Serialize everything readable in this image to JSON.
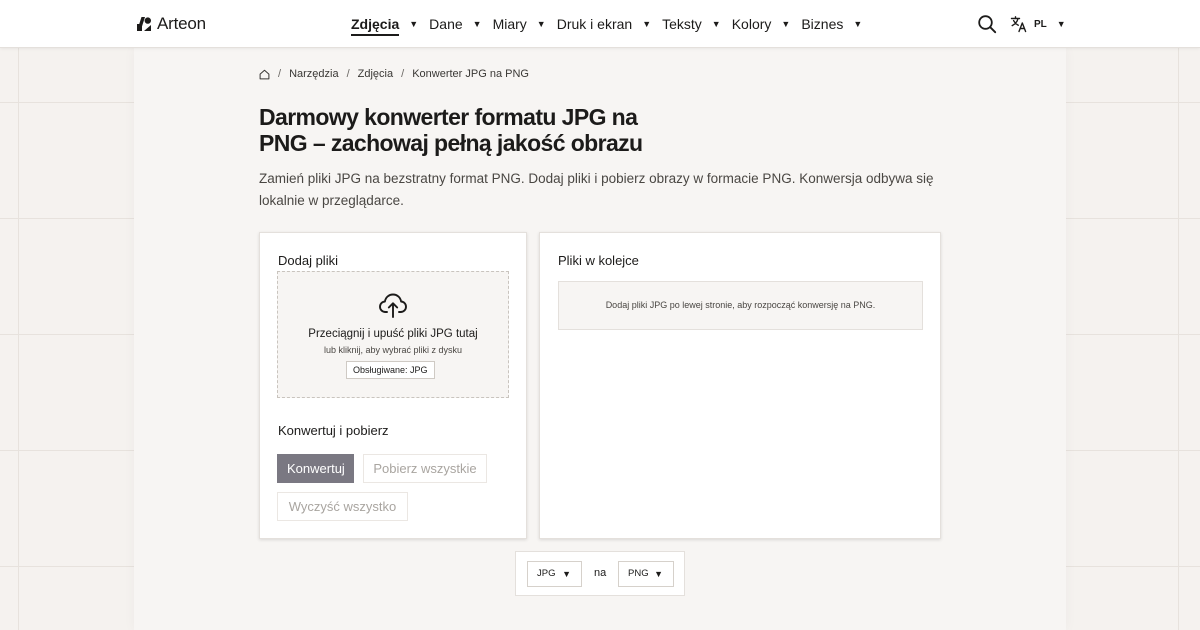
{
  "brand": {
    "name": "Arteon"
  },
  "nav": [
    {
      "label": "Zdjęcia",
      "active": true
    },
    {
      "label": "Dane",
      "active": false
    },
    {
      "label": "Miary",
      "active": false
    },
    {
      "label": "Druk i ekran",
      "active": false
    },
    {
      "label": "Teksty",
      "active": false
    },
    {
      "label": "Kolory",
      "active": false
    },
    {
      "label": "Biznes",
      "active": false
    }
  ],
  "header": {
    "language": "PL",
    "search_icon": "search-icon",
    "language_icon": "translate-icon"
  },
  "breadcrumb": {
    "home_icon": "home-icon",
    "items": [
      "Narzędzia",
      "Zdjęcia"
    ],
    "current": "Konwerter JPG na PNG"
  },
  "page": {
    "title": "Darmowy konwerter formatu JPG na PNG – zachowaj pełną jakość obrazu",
    "description": "Zamień pliki JPG na bezstratny format PNG. Dodaj pliki i pobierz obrazy w formacie PNG. Konwersja odbywa się lokalnie w przeglądarce."
  },
  "upload": {
    "title": "Dodaj pliki",
    "icon": "cloud-upload-icon",
    "drop_text": "Przeciągnij i upuść pliki JPG tutaj",
    "click_text": "lub kliknij, aby wybrać pliki z dysku",
    "supported": "Obsługiwane: JPG"
  },
  "convert": {
    "title": "Konwertuj i pobierz",
    "convert_label": "Konwertuj",
    "download_all_label": "Pobierz wszystkie",
    "clear_all_label": "Wyczyść wszystko"
  },
  "queue": {
    "title": "Pliki w kolejce",
    "empty_text": "Dodaj pliki JPG po lewej stronie, aby rozpocząć konwersję na PNG."
  },
  "switcher": {
    "from": "JPG",
    "join": "na",
    "to": "PNG"
  },
  "colors": {
    "accent_button": "#7a7882",
    "background": "#f5f2ef",
    "text": "#1c1b1a"
  }
}
